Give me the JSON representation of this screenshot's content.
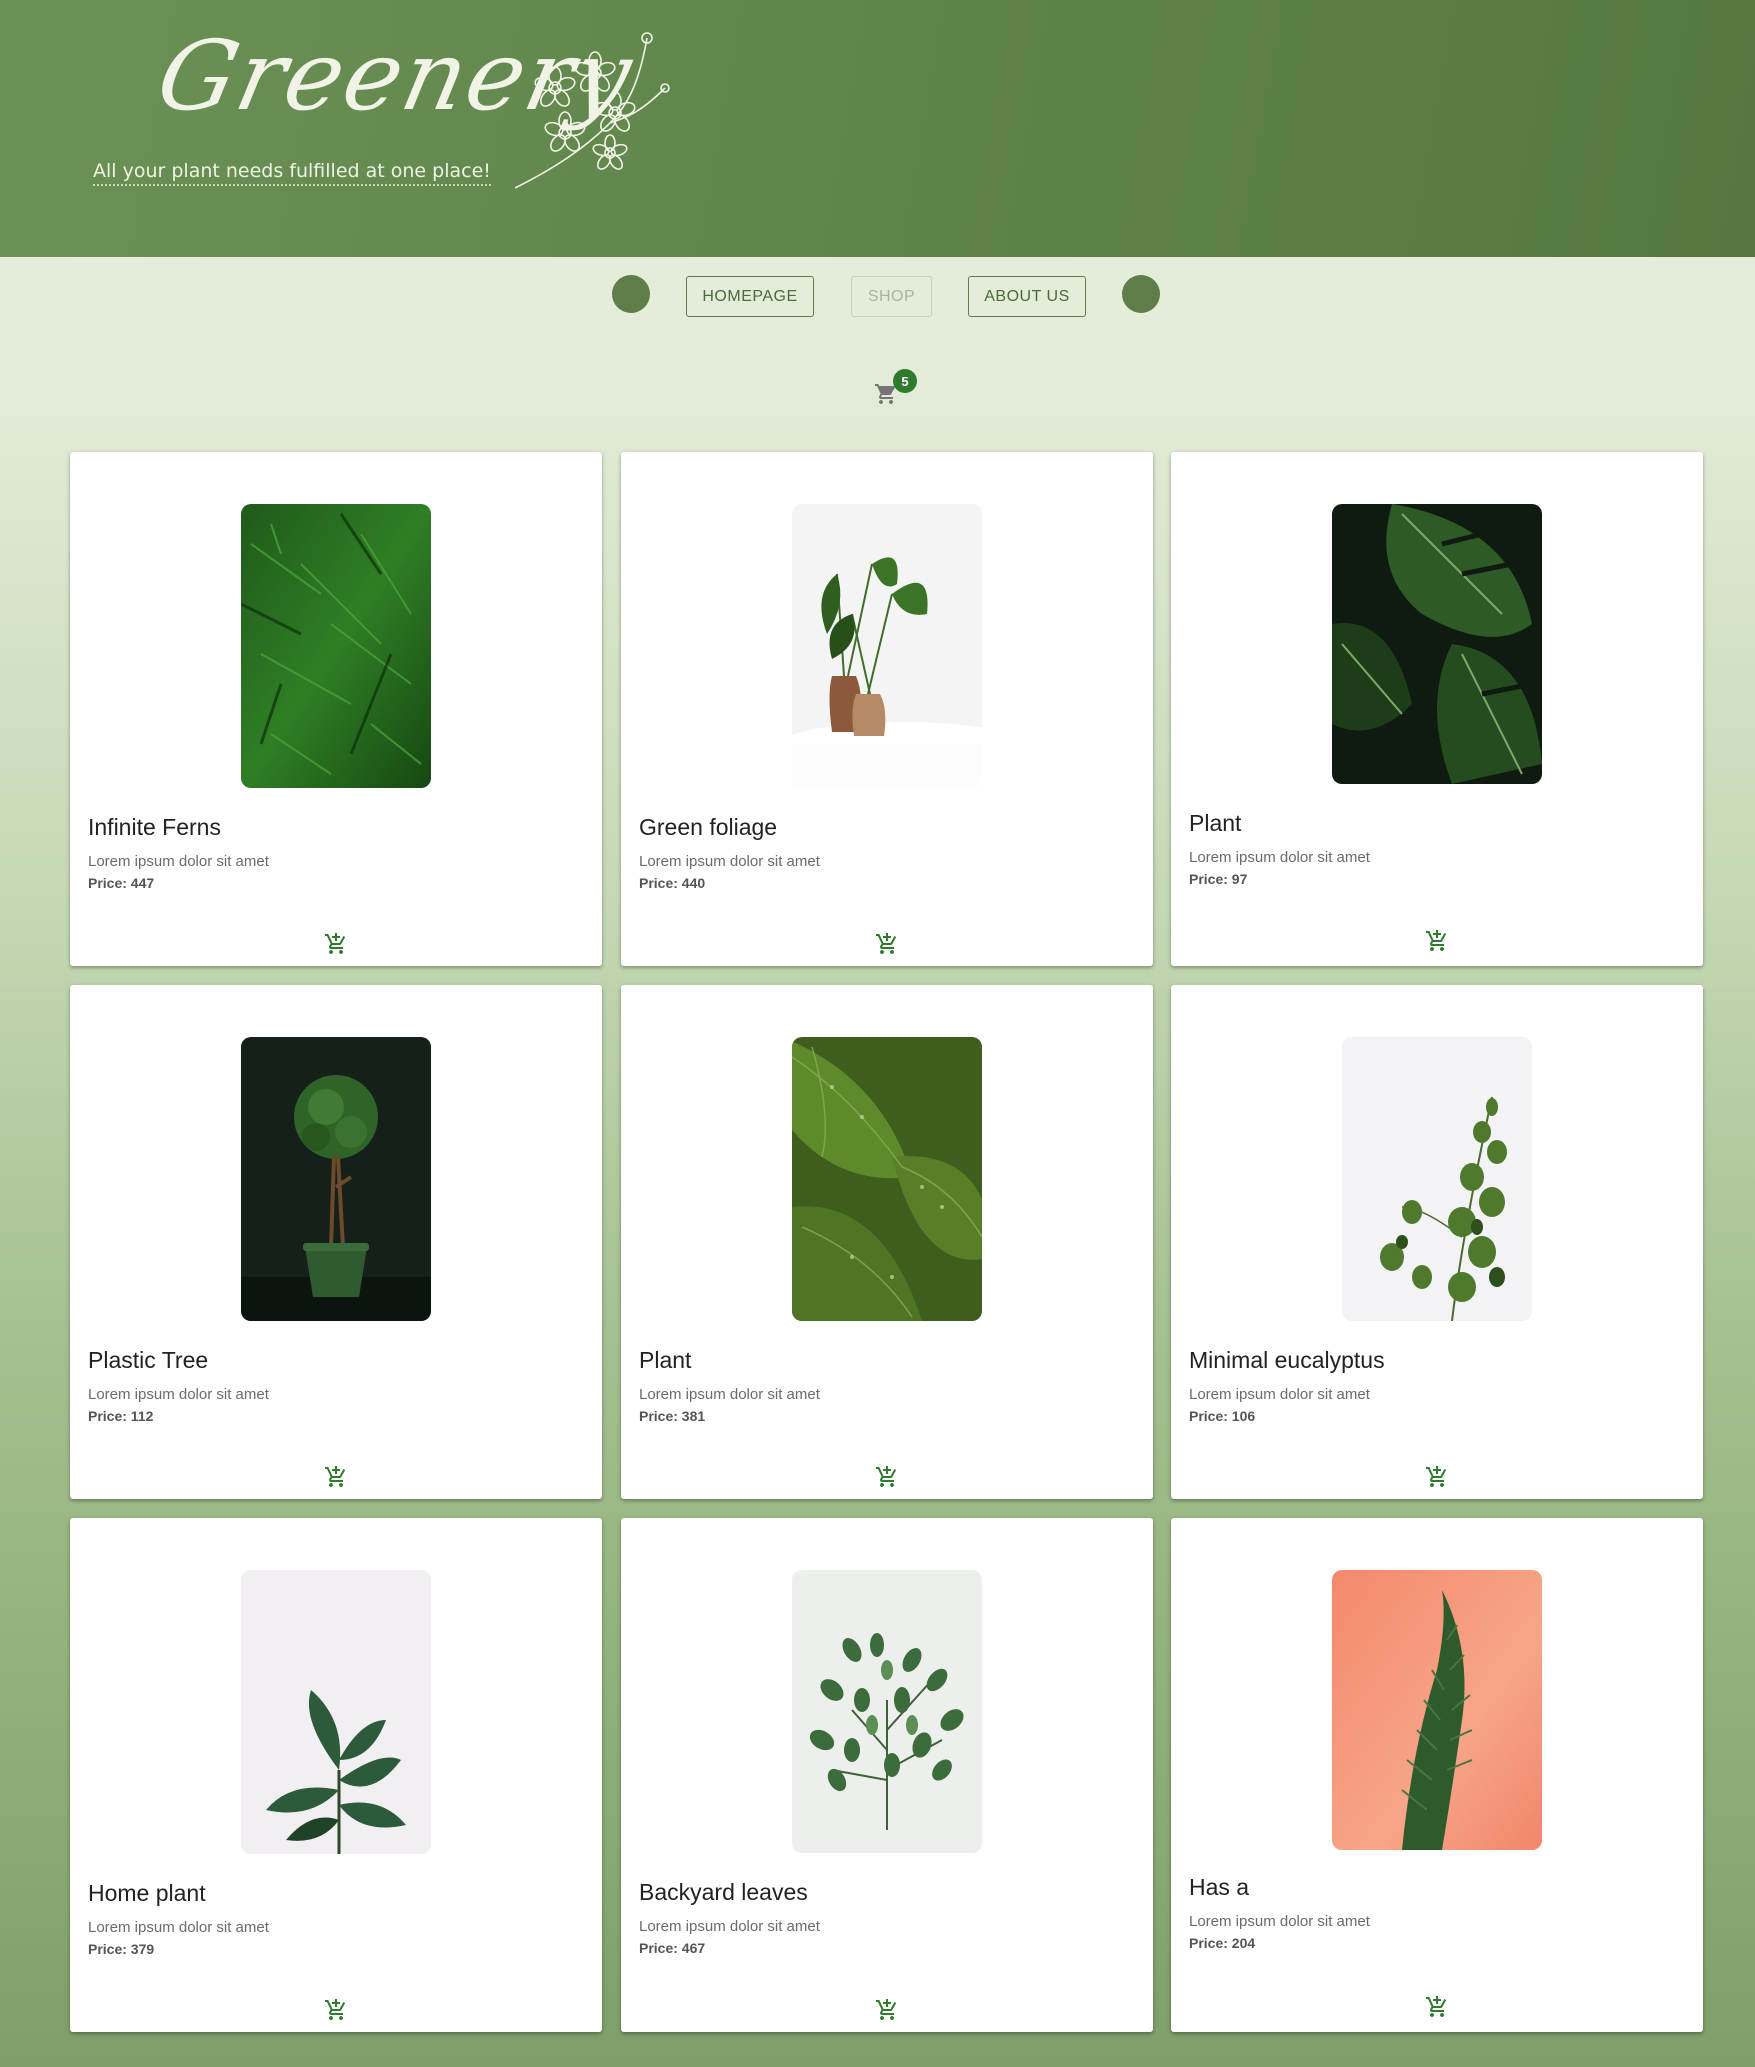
{
  "header": {
    "logo_text": "Greenery",
    "tagline": "All your plant needs fulfilled at one place!"
  },
  "nav": {
    "items": [
      {
        "label": "HOMEPAGE",
        "disabled": false
      },
      {
        "label": "SHOP",
        "disabled": true
      },
      {
        "label": "ABOUT US",
        "disabled": false
      }
    ]
  },
  "cart": {
    "count": "5",
    "icon": "shopping-cart-icon"
  },
  "colors": {
    "brand": "#5e7d48",
    "accent": "#2f7a2c",
    "header": "#5f8449"
  },
  "products": [
    {
      "name": "Infinite Ferns",
      "desc": "Lorem ipsum dolor sit amet",
      "price": "Price: 447",
      "image": "fern-leaves"
    },
    {
      "name": "Green foliage",
      "desc": "Lorem ipsum dolor sit amet",
      "price": "Price: 440",
      "image": "plant-in-wooden-vases"
    },
    {
      "name": "Plant",
      "desc": "Lorem ipsum dolor sit amet",
      "price": "Price: 97",
      "image": "monstera-leaves"
    },
    {
      "name": "Plastic Tree",
      "desc": "Lorem ipsum dolor sit amet",
      "price": "Price: 112",
      "image": "topiary-tree-in-pot"
    },
    {
      "name": "Plant",
      "desc": "Lorem ipsum dolor sit amet",
      "price": "Price: 381",
      "image": "hosta-leaves-with-droplets"
    },
    {
      "name": "Minimal eucalyptus",
      "desc": "Lorem ipsum dolor sit amet",
      "price": "Price: 106",
      "image": "eucalyptus-branch"
    },
    {
      "name": "Home plant",
      "desc": "Lorem ipsum dolor sit amet",
      "price": "Price: 379",
      "image": "rubber-plant"
    },
    {
      "name": "Backyard leaves",
      "desc": "Lorem ipsum dolor sit amet",
      "price": "Price: 467",
      "image": "leafy-branch"
    },
    {
      "name": "Has a",
      "desc": "Lorem ipsum dolor sit amet",
      "price": "Price: 204",
      "image": "conifer-on-peach"
    }
  ]
}
